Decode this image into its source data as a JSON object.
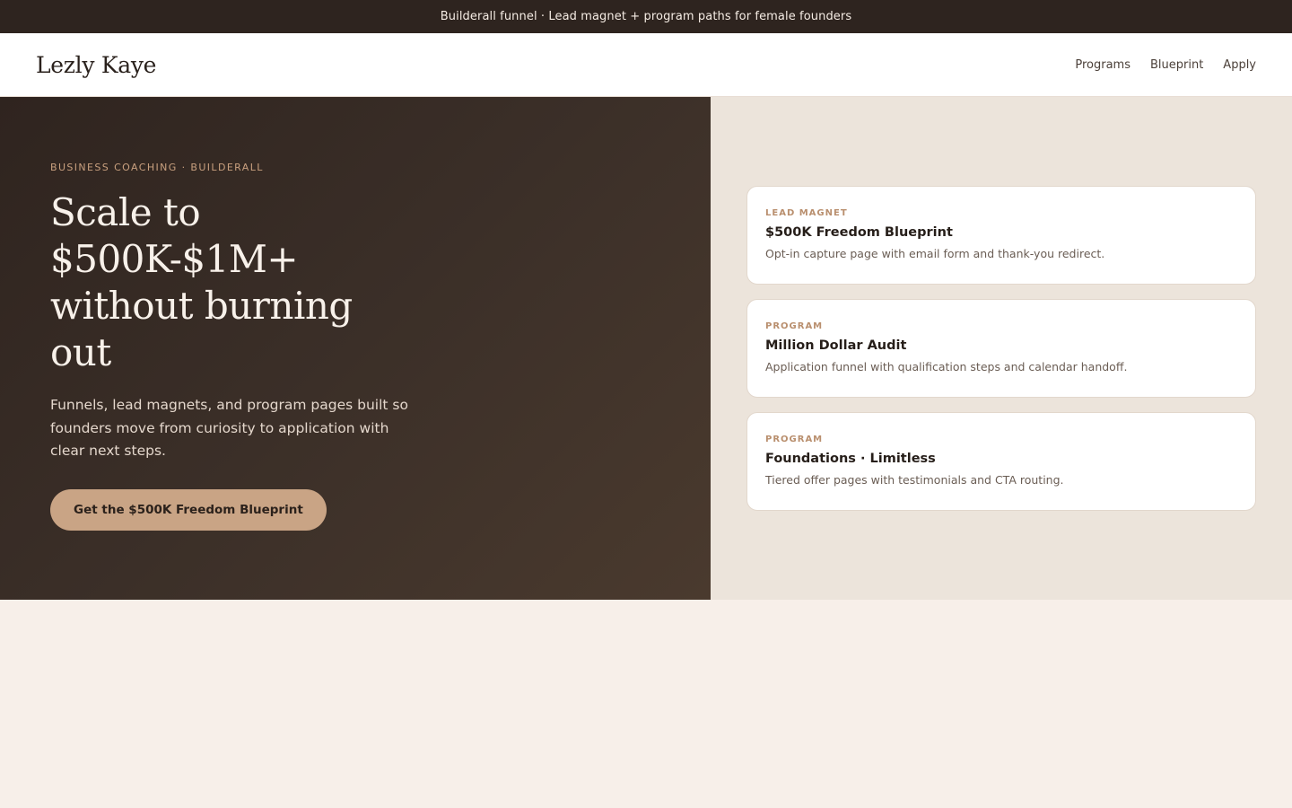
{
  "announcement": "Builderall funnel · Lead magnet + program paths for female founders",
  "nav": {
    "brand": "Lezly Kaye",
    "links": [
      "Programs",
      "Blueprint",
      "Apply"
    ]
  },
  "hero": {
    "eyebrow": "BUSINESS COACHING · BUILDERALL",
    "headline": "Scale to $500K-$1M+ without burning out",
    "lede": "Funnels, lead magnets, and program pages built so founders move from curiosity to application with clear next steps.",
    "cta_label": "Get the $500K Freedom Blueprint"
  },
  "cards": [
    {
      "tag": "LEAD MAGNET",
      "title": "$500K Freedom Blueprint",
      "desc": "Opt-in capture page with email form and thank-you redirect."
    },
    {
      "tag": "PROGRAM",
      "title": "Million Dollar Audit",
      "desc": "Application funnel with qualification steps and calendar handoff."
    },
    {
      "tag": "PROGRAM",
      "title": "Foundations · Limitless",
      "desc": "Tiered offer pages with testimonials and CTA routing."
    }
  ],
  "colors": {
    "announce_bg": "#2e241f",
    "hero_dark": "#3b2f28",
    "accent": "#c9a485",
    "panel_bg": "#ece4db",
    "page_bg": "#f7efe9"
  }
}
